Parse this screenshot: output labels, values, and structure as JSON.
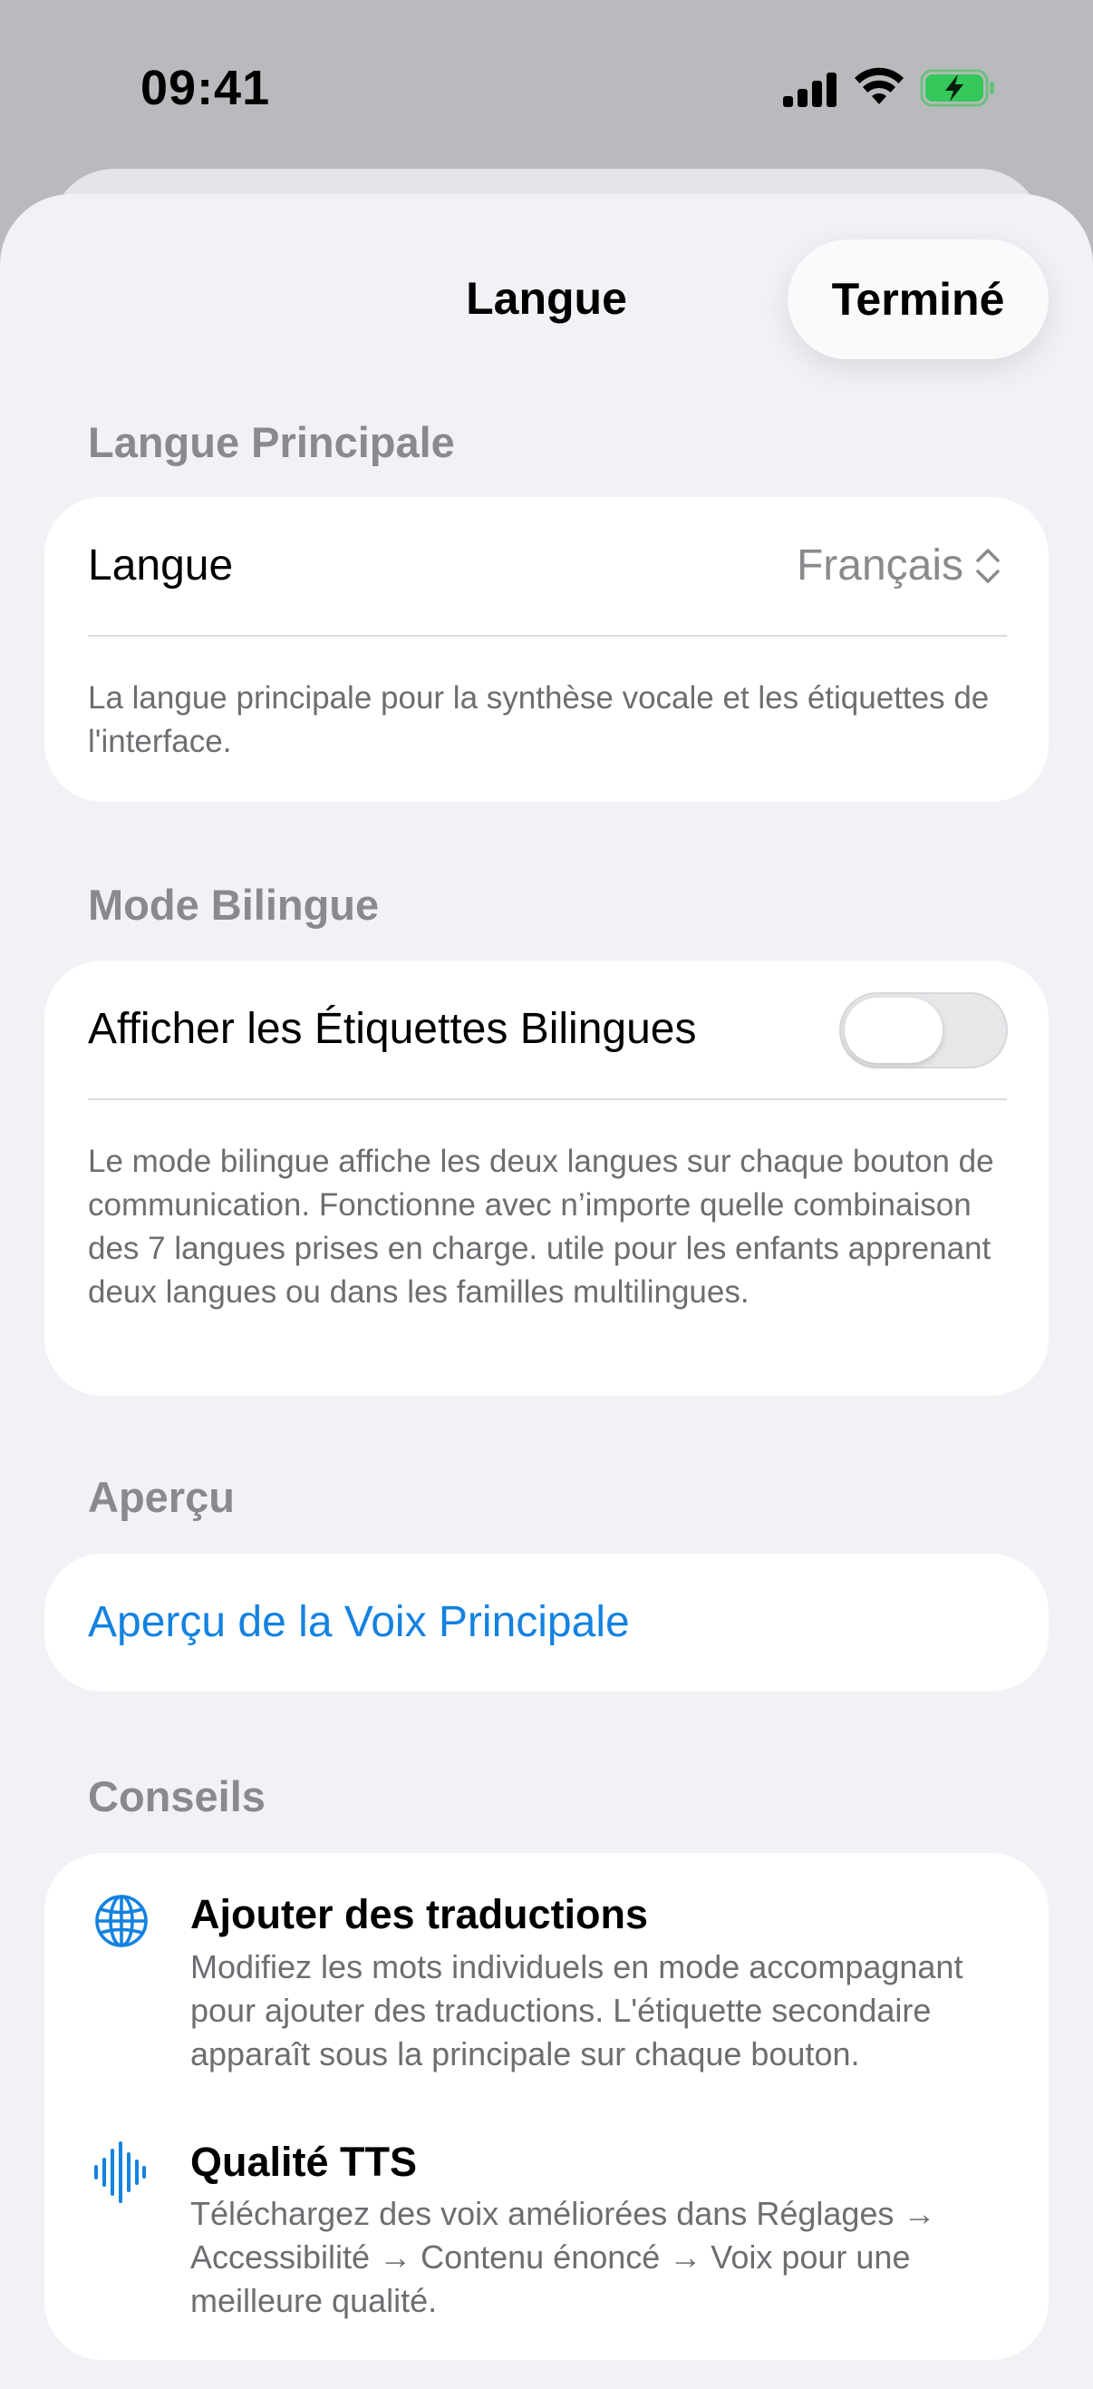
{
  "status_bar": {
    "time": "09:41"
  },
  "nav": {
    "title": "Langue",
    "done_label": "Terminé"
  },
  "primary_language": {
    "header": "Langue Principale",
    "row_label": "Langue",
    "row_value": "Français",
    "footnote": "La langue principale pour la synthèse vocale et les étiquettes de l'interface."
  },
  "bilingual": {
    "header": "Mode Bilingue",
    "toggle_label": "Afficher les Étiquettes Bilingues",
    "toggle_on": false,
    "footnote": "Le mode bilingue affiche les deux langues sur chaque bouton de communication. Fonctionne avec n’importe quelle combinaison des 7 langues prises en charge. utile pour les enfants apprenant deux langues ou dans les familles multilingues."
  },
  "preview": {
    "header": "Aperçu",
    "link_label": "Aperçu de la Voix Principale"
  },
  "tips": {
    "header": "Conseils",
    "items": [
      {
        "icon": "globe-icon",
        "title": "Ajouter des traductions",
        "body": "Modifiez les mots individuels en mode accompagnant pour ajouter des traductions. L'étiquette secondaire apparaît sous la principale sur chaque bouton."
      },
      {
        "icon": "waveform-icon",
        "title": "Qualité TTS",
        "body": "Téléchargez des voix améliorées dans Réglages → Accessibilité → Contenu énoncé → Voix pour une meilleure qualité."
      }
    ]
  },
  "colors": {
    "accent": "#1482e0",
    "battery": "#34c759",
    "secondary_text": "#8a8a8e"
  }
}
